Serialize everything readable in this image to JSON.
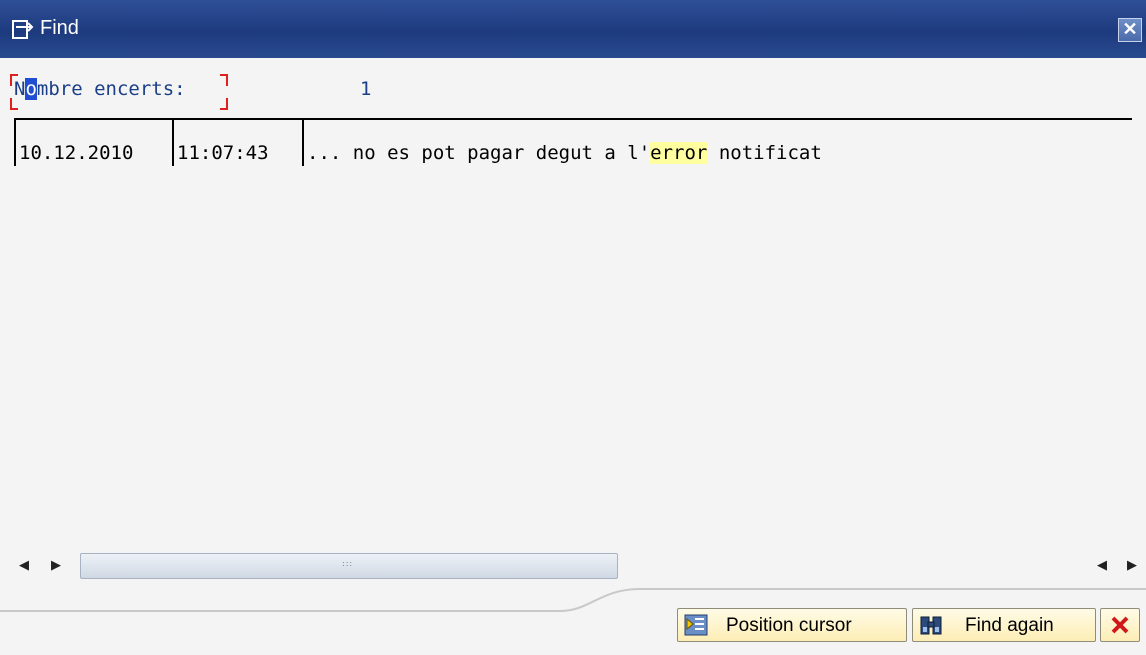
{
  "window": {
    "title": "Find",
    "close_symbol": "✕"
  },
  "hits": {
    "label": "Nombre encerts:",
    "value": "1"
  },
  "result": {
    "date": "10.12.2010",
    "time": "11:07:43",
    "text_before": "... no es pot pagar degut a l'",
    "match": "error",
    "text_after": " notificat"
  },
  "scroll": {
    "left": "◀",
    "right": "▶",
    "grip": ":::"
  },
  "buttons": {
    "position_cursor": "Position cursor",
    "find_again": "Find again"
  },
  "colors": {
    "titlebar": "#1d3a7e",
    "highlight": "#ffffa0",
    "button_bg": "#fdeeb5",
    "label_text": "#1b3f87"
  }
}
